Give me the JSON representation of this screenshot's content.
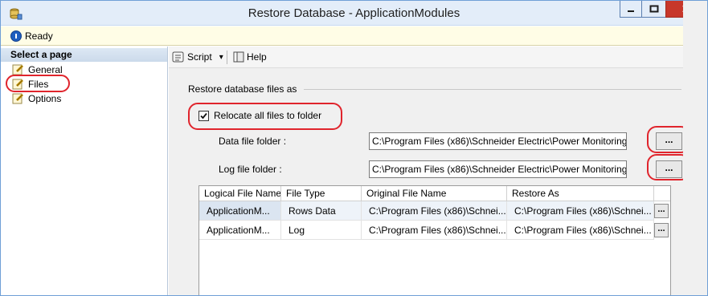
{
  "window": {
    "title": "Restore Database - ApplicationModules",
    "minimize_glyph": "–",
    "maximize_glyph": "□",
    "close_glyph": "✕"
  },
  "status": {
    "text": "Ready"
  },
  "nav": {
    "header": "Select a page",
    "items": [
      {
        "label": "General"
      },
      {
        "label": "Files"
      },
      {
        "label": "Options"
      }
    ]
  },
  "toolbar": {
    "script_label": "Script",
    "script_arrow": "▾",
    "help_label": "Help"
  },
  "files": {
    "section_title": "Restore database files as",
    "relocate_label": "Relocate all files to folder",
    "relocate_checked": true,
    "data_folder_label": "Data file folder :",
    "data_folder_value": "C:\\Program Files (x86)\\Schneider Electric\\Power Monitoring",
    "log_folder_label": "Log file folder :",
    "log_folder_value": "C:\\Program Files (x86)\\Schneider Electric\\Power Monitoring",
    "browse_label": "..."
  },
  "grid": {
    "columns": [
      "Logical File Name",
      "File Type",
      "Original File Name",
      "Restore As"
    ],
    "rows": [
      [
        "ApplicationM...",
        "Rows Data",
        "C:\\Program Files (x86)\\Schnei...",
        "C:\\Program Files (x86)\\Schnei..."
      ],
      [
        "ApplicationM...",
        "Log",
        "C:\\Program Files (x86)\\Schnei...",
        "C:\\Program Files (x86)\\Schnei..."
      ]
    ],
    "row_button_label": "..."
  },
  "colors": {
    "highlight_outline": "#e0242c",
    "close_button": "#c7372a",
    "status_background": "#fffde6"
  }
}
